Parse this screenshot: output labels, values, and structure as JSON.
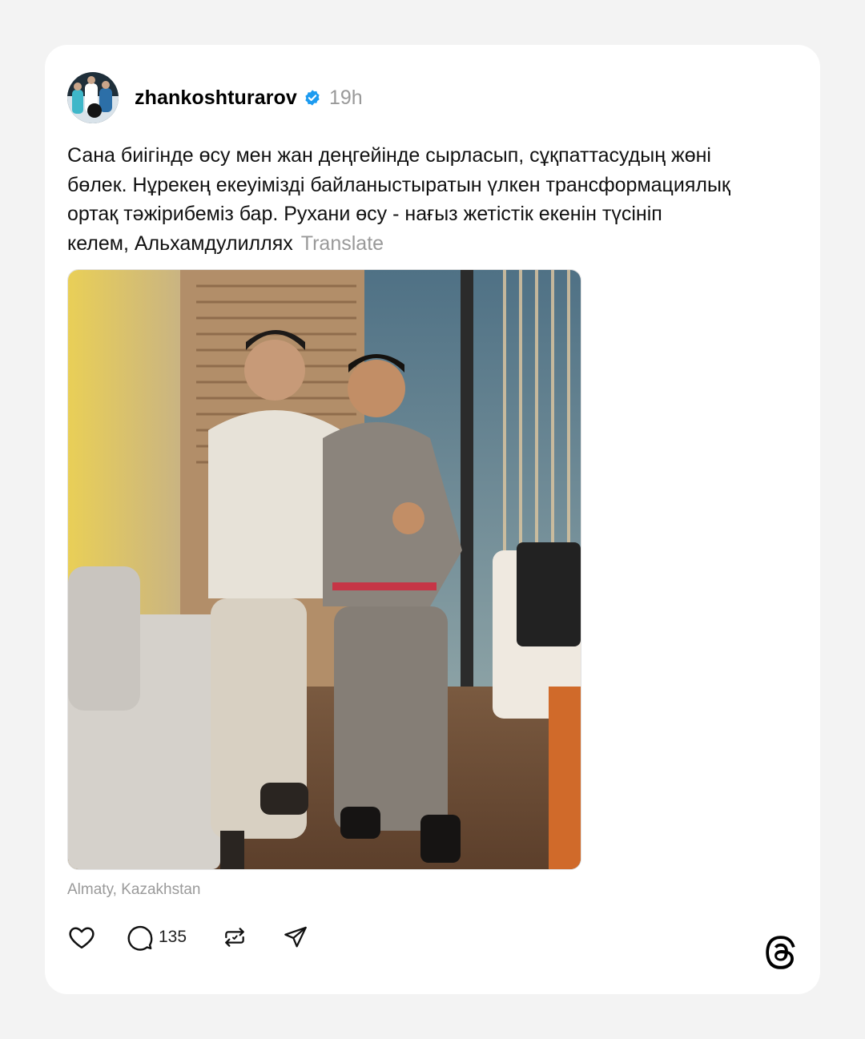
{
  "post": {
    "username": "zhankoshturarov",
    "time": "19h",
    "text_lines": [
      "Сана биігінде өсу мен жан деңгейінде сырласып, сұқпаттасудың жөні",
      "бөлек. Нұрекең екеуімізді байланыстыратын үлкен трансформациялық",
      "ортақ тәжірибеміз бар. Рухани өсу - нағыз жетістік екенін түсініп",
      "келем, Альхамдулиллях"
    ],
    "translate_label": "Translate",
    "location": "Almaty, Kazakhstan",
    "reply_count": "135"
  },
  "icons": {
    "verified": "verified-badge-icon",
    "like": "heart-icon",
    "reply": "comment-icon",
    "repost": "repost-icon",
    "share": "send-icon",
    "brand": "threads-logo-icon"
  },
  "colors": {
    "verified_blue": "#1d9bf0",
    "muted_text": "#999999",
    "background": "#f3f3f3",
    "card": "#ffffff"
  }
}
